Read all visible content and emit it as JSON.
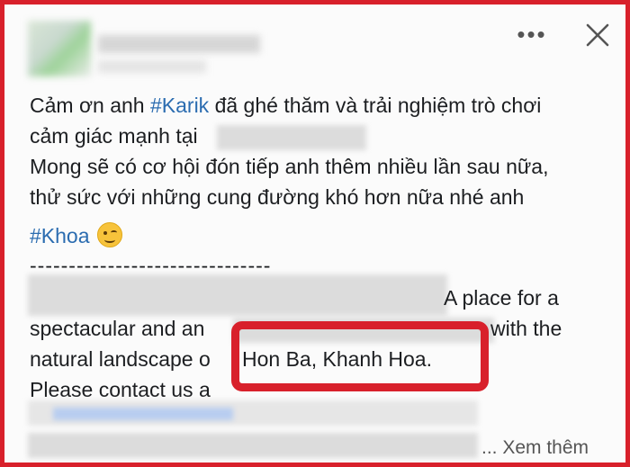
{
  "post": {
    "line1_before": "Cảm ơn anh ",
    "line1_tag": "#Karik",
    "line1_after": " đã ghé thăm và trải nghiệm trò chơi",
    "line2": "cảm giác mạnh tại",
    "line3": "Mong sẽ có cơ hội đón tiếp anh thêm nhiều lần sau nữa,",
    "line4": "thử sức với những cung đường khó hơn nữa nhé anh",
    "hashtag2": "#Khoa",
    "divider": "-------------------------------",
    "line6_visible": "A place for a",
    "line7_a": "spectacular and an",
    "line7_b": "with the",
    "line8_a": "natural landscape o",
    "line8_b": "Hon Ba, Khanh Hoa.",
    "line9": "Please contact us a",
    "see_more": "... Xem thêm"
  },
  "header": {
    "more_icon": "more-horizontal-icon",
    "close_icon": "close-icon"
  },
  "colors": {
    "accent_red": "#d8202b",
    "hashtag_blue": "#2b6cb0"
  }
}
